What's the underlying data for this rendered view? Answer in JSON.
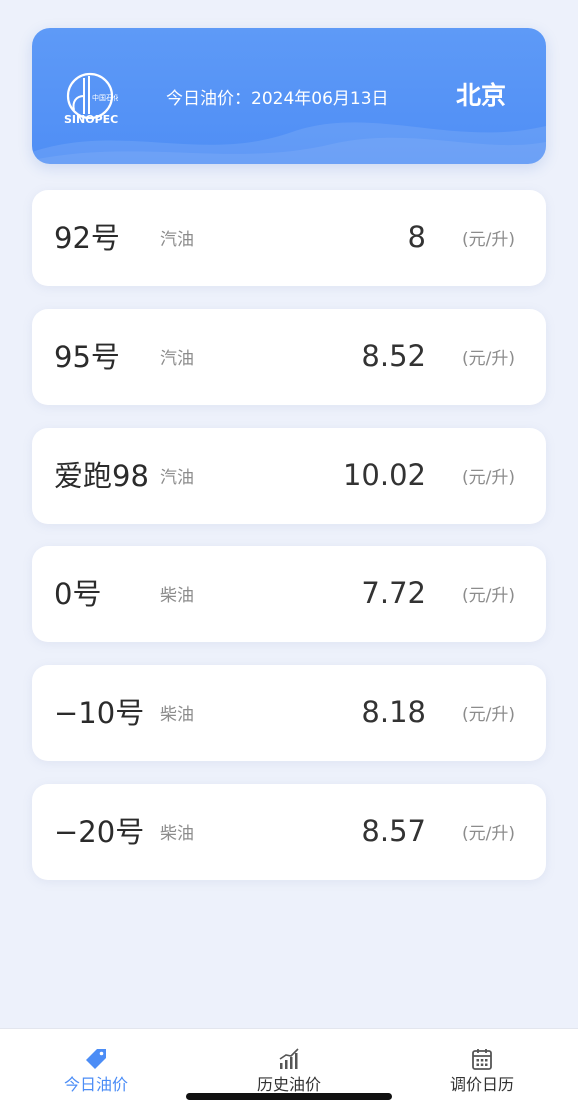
{
  "header": {
    "date_label": "今日油价：2024年06月13日",
    "city": "北京",
    "accent_color": "#4f8ef5"
  },
  "prices": [
    {
      "grade": "92号",
      "type": "汽油",
      "price": "8",
      "unit": "(元/升)"
    },
    {
      "grade": "95号",
      "type": "汽油",
      "price": "8.52",
      "unit": "(元/升)"
    },
    {
      "grade": "爱跑98",
      "type": "汽油",
      "price": "10.02",
      "unit": "(元/升)"
    },
    {
      "grade": "0号",
      "type": "柴油",
      "price": "7.72",
      "unit": "(元/升)"
    },
    {
      "grade": "−10号",
      "type": "柴油",
      "price": "8.18",
      "unit": "(元/升)"
    },
    {
      "grade": "−20号",
      "type": "柴油",
      "price": "8.57",
      "unit": "(元/升)"
    }
  ],
  "tabbar": {
    "tabs": [
      {
        "label": "今日油价",
        "icon": "price-tag-icon",
        "active": true
      },
      {
        "label": "历史油价",
        "icon": "bar-chart-icon",
        "active": false
      },
      {
        "label": "调价日历",
        "icon": "calendar-icon",
        "active": false
      }
    ]
  }
}
